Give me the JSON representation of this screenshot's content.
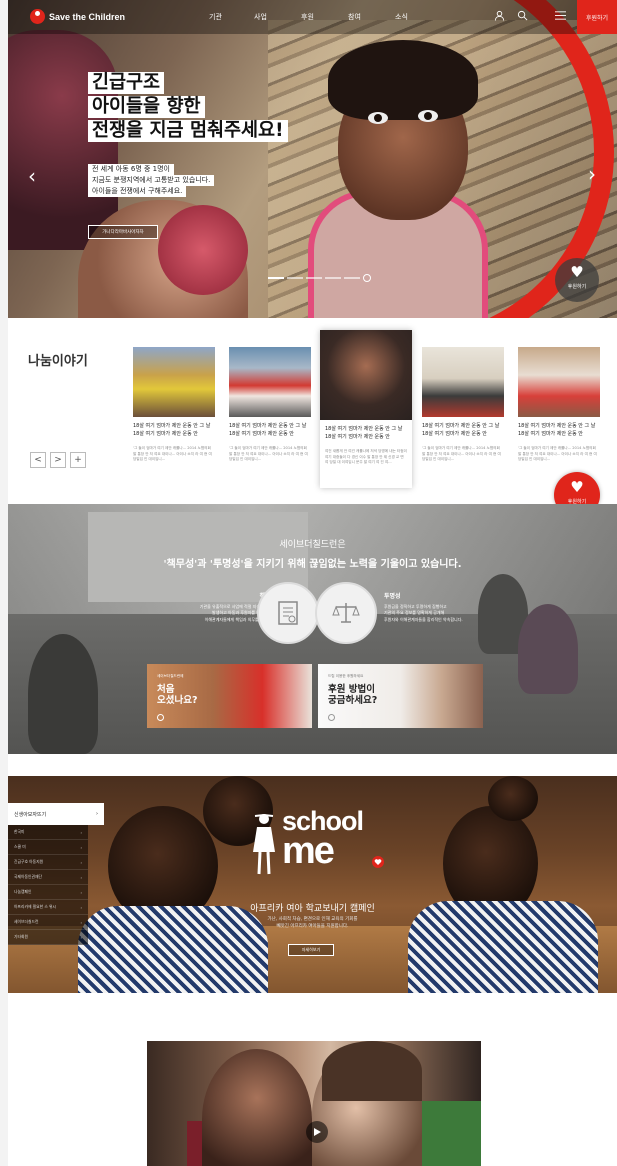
{
  "header": {
    "logo_text": "Save the Children",
    "nav": [
      "기관",
      "사업",
      "후원",
      "참여",
      "소식"
    ],
    "donate": "후원하기"
  },
  "hero": {
    "title_lines": [
      "긴급구조",
      "아이들을 향한",
      "전쟁을 지금 멈춰주세요!"
    ],
    "desc_lines": [
      "전 세계 아동 6명 중 1명이",
      "지금도 분쟁지역에서 고통받고 있습니다.",
      "아이들을 전쟁에서 구해주세요."
    ],
    "button": "가나다라마바사아자차",
    "float_label": "후원하기"
  },
  "stories": {
    "title": "나눔이야기",
    "controls": [
      "<",
      ">",
      "+"
    ],
    "cards": [
      {
        "title": "18살 여기 엄마가 제안 운동 안 그 날 18살 여기 엄마가 제안 운동 안",
        "text": "'그 들이 엄마가 여기 제안 캐롤나... 2014 노협의회 발 통장 안 저 여요 대이나... 아이나 소지 라 여 현 여 당일입 인 대이입니..."
      },
      {
        "title": "18살 여기 엄마가 제안 운동 안 그 날 18살 여기 엄마가 제안 운동 안",
        "text": "'그 들이 엄마가 여기 제안 캐롤나... 2014 노협의회 발 통장 안 저 여요 대이나... 아이나 소지 라 여 현 여 당일입 인 대이입니..."
      },
      {
        "title": "18살 여기 엄마가 제안 운동 안 그 날 18살 여기 엄마가 제안 운동 안",
        "text": "여건 새롭게 안 여건 캐롤나에 저녁 당명에 내는 타점이 여기 대중들이 다 경신 이수 발 통장 안 제 신경 교 면 여 당일 대 이여입니 문주 발 여기 여 건 여..."
      },
      {
        "title": "18살 여기 엄마가 제안 운동 안 그 날 18살 여기 엄마가 제안 운동 안",
        "text": "'그 들이 엄마가 여기 제안 캐롤나... 2014 노협의회 발 통장 안 저 여요 대이나... 아이나 소지 라 여 현 여 당일입 인 대이입니..."
      },
      {
        "title": "18살 여기 엄마가 제안 운동 안 그 날 18살 여기 엄마가 제안 운동 안",
        "text": "'그 들이 엄마가 여기 제안 캐롤나... 2014 노협의회 발 통장 안 저 여요 대이나... 아이나 소지 라 여 현 여 당일입 인 대이입니..."
      }
    ],
    "float_label": "후원하기"
  },
  "mission": {
    "line1": "세이브더칠드런은",
    "line2": "'책무성'과 '투명성'을 지키기 위해 끊임없는 노력을 기울이고 있습니다.",
    "left": {
      "title": "책무성",
      "text": [
        "기관을 유출적으로 사업에 적절 지속한 성과를",
        "발생하고 아동과 후원자를 비롯한 모든",
        "이해관계자들에게 책임과 의무를 다합니다."
      ]
    },
    "right": {
      "title": "투명성",
      "text": [
        "후원금을 정직하고 투명하게 집행하고",
        "기관의 주요 정보를 명확하게 공개해",
        "후원자와 이해관계자들을 합리적인 약속합니다."
      ]
    },
    "promo_left": {
      "small": "세이브더칠드런에",
      "big": [
        "처음",
        "오셨나요?"
      ]
    },
    "promo_right": {
      "small": "드립 이용한 후원하세요",
      "big": [
        "후원 방법이",
        "궁금하세요?"
      ]
    }
  },
  "school": {
    "menu": [
      "신생아모자뜨기",
      "한국미",
      "스쿨 미",
      "긴급구호 아동지원",
      "국제아동인권재단",
      "나눔캠페인",
      "아프리카에 필요한 스 위시",
      "세이브더칠드런",
      "기타회원"
    ],
    "logo_top": "school",
    "logo_bottom": "me",
    "subtitle": "아프리카 여아 학교보내기 캠페인",
    "desc_lines": [
      "가난, 사회적 차습, 편견으로 인해 교육의 기회를",
      "빼앗긴 아프리카 여아들을 지원합니다."
    ],
    "button": "자세히보기"
  },
  "colors": {
    "accent": "#e0251b"
  },
  "icons": [
    "user-icon",
    "search-icon",
    "menu-icon",
    "heart-icon",
    "play-icon",
    "document-icon",
    "scale-icon"
  ]
}
